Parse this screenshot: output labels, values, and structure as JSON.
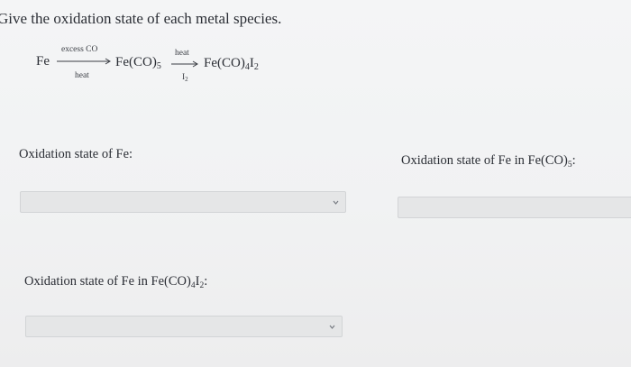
{
  "question": {
    "text": "Give the oxidation state of each metal species."
  },
  "reaction": {
    "reactant": "Fe",
    "arrow1_above": "excess CO",
    "arrow1_below": "heat",
    "intermediate_base": "Fe(CO)",
    "intermediate_sub": "5",
    "arrow2_above": "heat",
    "arrow2_below_base": "I",
    "arrow2_below_sub": "2",
    "product_base": "Fe(CO)",
    "product_sub1": "4",
    "product_mid": "I",
    "product_sub2": "2"
  },
  "fields": [
    {
      "label_text": "Oxidation state of Fe:",
      "selected_value": ""
    },
    {
      "label_prefix": "Oxidation state of Fe in Fe(CO)",
      "label_sub": "5",
      "label_suffix": ":",
      "selected_value": ""
    },
    {
      "label_prefix": "Oxidation state of Fe in Fe(CO)",
      "label_sub1": "4",
      "label_mid": "I",
      "label_sub2": "2",
      "label_suffix": ":",
      "selected_value": ""
    }
  ],
  "icons": {
    "dropdown_caret": "chevron-down-icon",
    "reaction_arrow": "arrow-right-icon"
  }
}
